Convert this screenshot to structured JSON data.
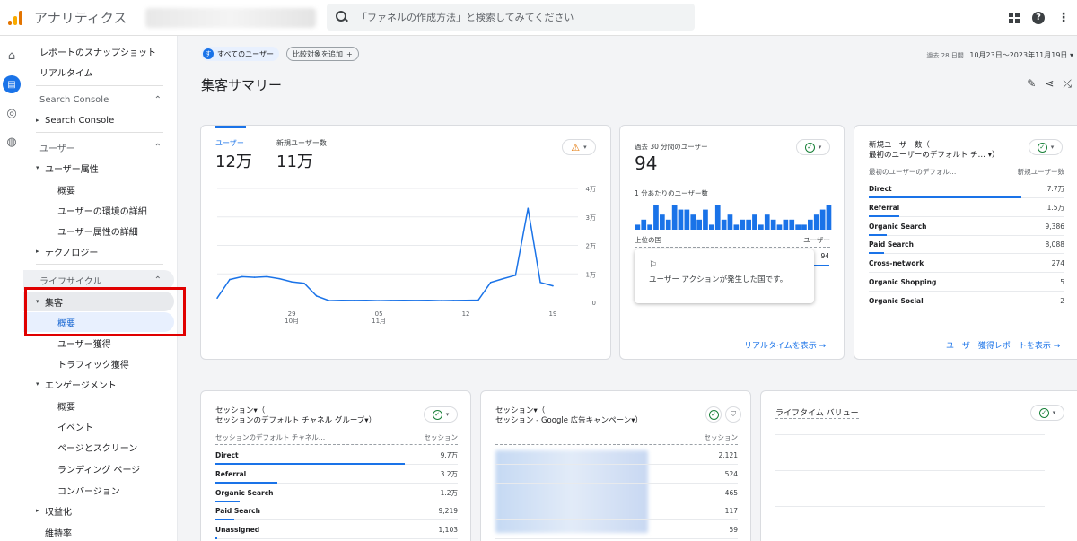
{
  "app": {
    "title": "アナリティクス"
  },
  "search": {
    "placeholder": "「ファネルの作成方法」と検索してみてください"
  },
  "sidebar": {
    "snapshot": "レポートのスナップショット",
    "realtime": "リアルタイム",
    "search_console_header": "Search Console",
    "search_console_item": "Search Console",
    "user_header": "ユーザー",
    "user_attr": "ユーザー属性",
    "overview": "概要",
    "env_detail": "ユーザーの環境の詳細",
    "attr_detail": "ユーザー属性の詳細",
    "technology": "テクノロジー",
    "lifecycle_header": "ライフサイクル",
    "acquisition": "集客",
    "acq_overview": "概要",
    "user_acq": "ユーザー獲得",
    "traffic_acq": "トラフィック獲得",
    "engagement": "エンゲージメント",
    "eng_overview": "概要",
    "events": "イベント",
    "pages": "ページとスクリーン",
    "landing": "ランディング ページ",
    "conversions": "コンバージョン",
    "monetization": "収益化",
    "retention": "維持率"
  },
  "header": {
    "segment_chip": "すべてのユーザー",
    "segment_initial": "す",
    "add_compare": "比較対象を追加",
    "date_prefix": "過去 28 日間",
    "date_range": "10月23日～2023年11月19日",
    "page_title": "集客サマリー"
  },
  "users_card": {
    "metric1_label": "ユーザー",
    "metric1_value": "12万",
    "metric2_label": "新規ユーザー数",
    "metric2_value": "11万",
    "y_ticks": [
      "4万",
      "3万",
      "2万",
      "1万",
      "0"
    ],
    "x_ticks": [
      {
        "day": "29",
        "month": "10月"
      },
      {
        "day": "05",
        "month": "11月"
      },
      {
        "day": "12",
        "month": ""
      },
      {
        "day": "19",
        "month": ""
      }
    ]
  },
  "chart_data": {
    "type": "line",
    "xlabel": "",
    "ylabel": "",
    "ylim": [
      0,
      40000
    ],
    "x": [
      "10/23",
      "10/24",
      "10/25",
      "10/26",
      "10/27",
      "10/28",
      "10/29",
      "10/30",
      "10/31",
      "11/01",
      "11/02",
      "11/03",
      "11/04",
      "11/05",
      "11/06",
      "11/07",
      "11/08",
      "11/09",
      "11/10",
      "11/11",
      "11/12",
      "11/13",
      "11/14",
      "11/15",
      "11/16",
      "11/17",
      "11/18",
      "11/19"
    ],
    "series": [
      {
        "values": [
          1500,
          8000,
          9000,
          8800,
          9000,
          8300,
          7200,
          6700,
          2200,
          600,
          700,
          650,
          700,
          600,
          650,
          700,
          650,
          700,
          600,
          650,
          700,
          800,
          7000,
          8300,
          9500,
          33000,
          7000,
          5800
        ]
      }
    ],
    "grid": true
  },
  "realtime_card": {
    "label": "過去 30 分間のユーザー",
    "value": "94",
    "per_min_label": "1 分あたりのユーザー数",
    "top_country_label": "上位の国",
    "user_col": "ユーザー",
    "count": "94",
    "bars": [
      1,
      2,
      1,
      5,
      3,
      2,
      5,
      4,
      4,
      3,
      2,
      4,
      1,
      5,
      2,
      3,
      1,
      2,
      2,
      3,
      1,
      3,
      2,
      1,
      2,
      2,
      1,
      1,
      2,
      3,
      4,
      5
    ],
    "tooltip_text": "ユーザー アクションが発生した国です。",
    "link": "リアルタイムを表示"
  },
  "new_users_card": {
    "title_line1": "新規ユーザー数（",
    "title_line2": "最初のユーザーのデフォルト チ… ▾）",
    "col1": "最初のユーザーのデフォル…",
    "col2": "新規ユーザー数",
    "rows": [
      {
        "name": "Direct",
        "value": "7.7万",
        "bar": 1.0
      },
      {
        "name": "Referral",
        "value": "1.5万",
        "bar": 0.2
      },
      {
        "name": "Organic Search",
        "value": "9,386",
        "bar": 0.12
      },
      {
        "name": "Paid Search",
        "value": "8,088",
        "bar": 0.1
      },
      {
        "name": "Cross-network",
        "value": "274",
        "bar": 0.0
      },
      {
        "name": "Organic Shopping",
        "value": "5",
        "bar": 0.0
      },
      {
        "name": "Organic Social",
        "value": "2",
        "bar": 0.0
      }
    ],
    "link": "ユーザー獲得レポートを表示"
  },
  "sessions_card": {
    "title_line1": "セッション▾（",
    "title_line2": "セッションのデフォルト チャネル グループ▾）",
    "col1": "セッションのデフォルト チャネル…",
    "col2": "セッション",
    "rows": [
      {
        "name": "Direct",
        "value": "9.7万",
        "bar": 1.0
      },
      {
        "name": "Referral",
        "value": "3.2万",
        "bar": 0.33
      },
      {
        "name": "Organic Search",
        "value": "1.2万",
        "bar": 0.13
      },
      {
        "name": "Paid Search",
        "value": "9,219",
        "bar": 0.1
      },
      {
        "name": "Unassigned",
        "value": "1,103",
        "bar": 0.01
      }
    ]
  },
  "google_ads_card": {
    "title_line1": "セッション▾（",
    "title_line2": "セッション - Google 広告キャンペーン▾）",
    "col2": "セッション",
    "rows": [
      {
        "value": "2,121"
      },
      {
        "value": "524"
      },
      {
        "value": "465"
      },
      {
        "value": "117"
      },
      {
        "value": "59"
      }
    ]
  },
  "ltv_card": {
    "title": "ライフタイム バリュー"
  },
  "colors": {
    "accent": "#1a73e8",
    "highlight_border": "#e00000"
  },
  "icons": [
    "search-icon",
    "apps-grid-icon",
    "help-icon",
    "more-vert-icon",
    "home-icon",
    "reports-icon",
    "explore-icon",
    "advertising-icon",
    "warning-icon",
    "check-circle-icon",
    "share-icon",
    "edit-icon"
  ]
}
